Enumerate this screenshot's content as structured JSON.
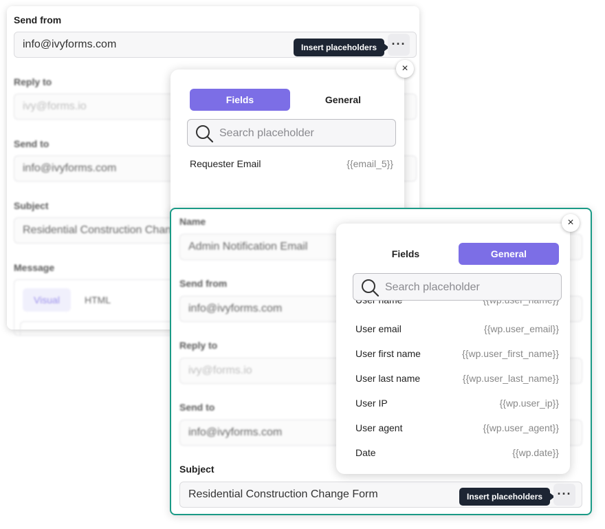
{
  "back": {
    "send_from": {
      "label": "Send from",
      "value": "info@ivyforms.com"
    },
    "reply_to": {
      "label": "Reply to",
      "placeholder": "ivy@forms.io"
    },
    "send_to": {
      "label": "Send to",
      "value": "info@ivyforms.com"
    },
    "subject": {
      "label": "Subject",
      "value": "Residential Construction Change Form"
    },
    "message": {
      "label": "Message",
      "tab_visual": "Visual",
      "tab_html": "HTML"
    },
    "tooltip": "Insert placeholders",
    "dots": "···"
  },
  "popup1": {
    "close": "×",
    "tab_fields": "Fields",
    "tab_general": "General",
    "search_placeholder": "Search placeholder",
    "items": [
      {
        "label": "Requester Email",
        "value": "{{email_5}}"
      }
    ]
  },
  "front": {
    "name": {
      "label": "Name",
      "value": "Admin Notification Email"
    },
    "send_from": {
      "label": "Send from",
      "value": "info@ivyforms.com"
    },
    "reply_to": {
      "label": "Reply to",
      "placeholder": "ivy@forms.io"
    },
    "send_to": {
      "label": "Send to",
      "value": "info@ivyforms.com"
    },
    "subject": {
      "label": "Subject",
      "value": "Residential Construction Change Form"
    },
    "tooltip": "Insert placeholders",
    "dots": "···"
  },
  "popup2": {
    "close": "×",
    "tab_fields": "Fields",
    "tab_general": "General",
    "search_placeholder": "Search placeholder",
    "partial": {
      "label": "User name",
      "value": "{{wp.user_name}}"
    },
    "items": [
      {
        "label": "User email",
        "value": "{{wp.user_email}}"
      },
      {
        "label": "User first name",
        "value": "{{wp.user_first_name}}"
      },
      {
        "label": "User last name",
        "value": "{{wp.user_last_name}}"
      },
      {
        "label": "User IP",
        "value": "{{wp.user_ip}}"
      },
      {
        "label": "User agent",
        "value": "{{wp.user_agent}}"
      },
      {
        "label": "Date",
        "value": "{{wp.date}}"
      }
    ]
  }
}
